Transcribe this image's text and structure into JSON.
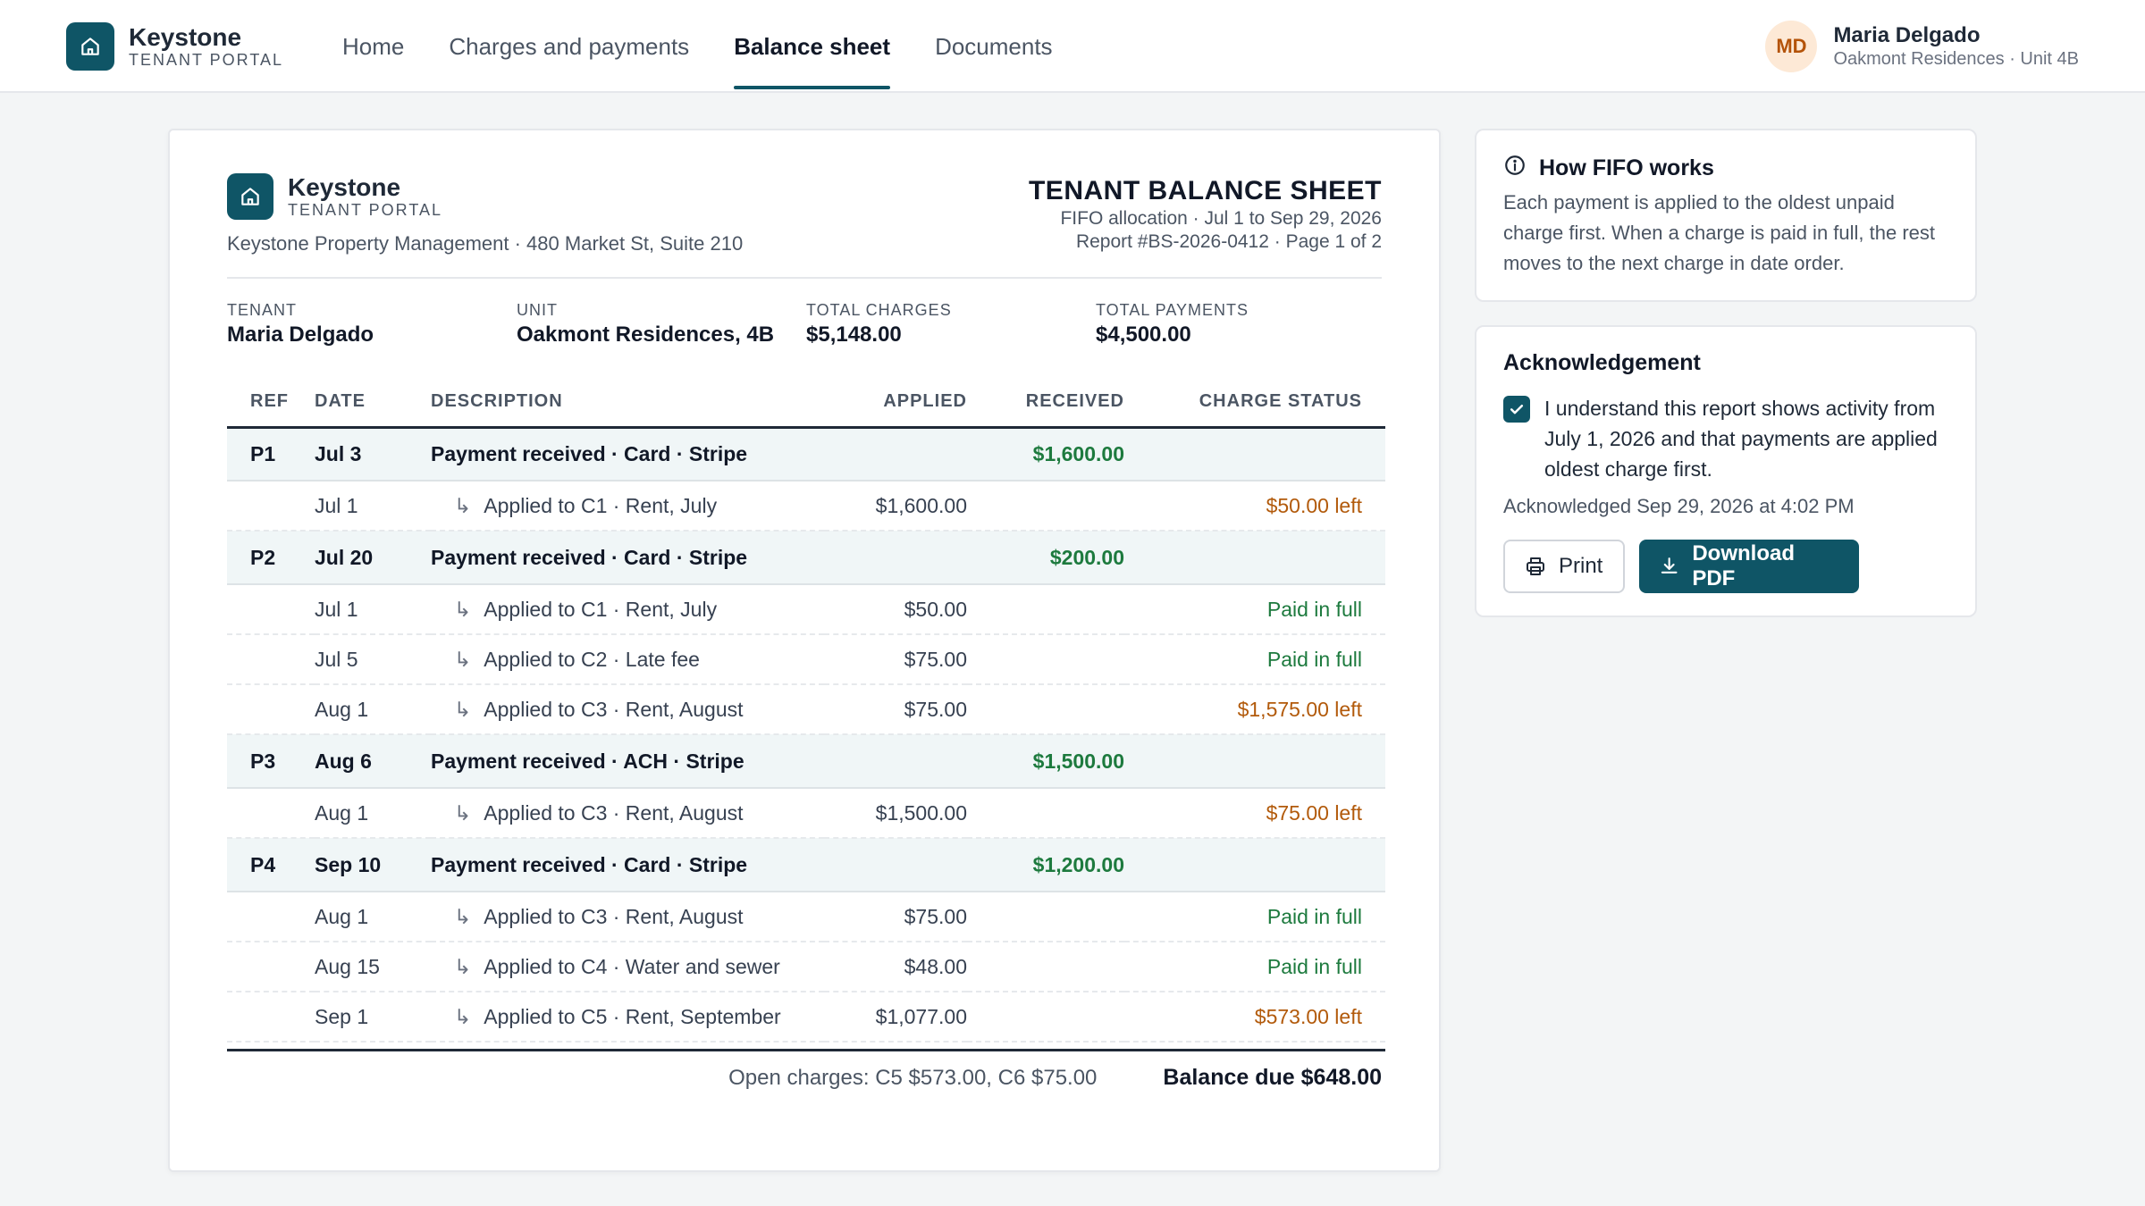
{
  "app": {
    "name": "Keystone",
    "subtitle": "TENANT PORTAL"
  },
  "nav": {
    "tabs": [
      "Home",
      "Charges and payments",
      "Balance sheet",
      "Documents"
    ],
    "active": "Balance sheet"
  },
  "user": {
    "initials": "MD",
    "name": "Maria Delgado",
    "property": "Oakmont Residences · Unit 4B"
  },
  "report": {
    "brand_name": "Keystone",
    "brand_sub": "TENANT PORTAL",
    "address": "Keystone Property Management · 480 Market St, Suite 210",
    "title": "TENANT BALANCE SHEET",
    "period": "FIFO allocation · Jul 1 to Sep 29, 2026",
    "report_id": "Report #BS-2026-0412 · Page 1 of 2",
    "summary": {
      "tenant_label": "TENANT",
      "tenant_value": "Maria Delgado",
      "unit_label": "UNIT",
      "unit_value": "Oakmont Residences, 4B",
      "charges_label": "TOTAL CHARGES",
      "charges_value": "$5,148.00",
      "payments_label": "TOTAL PAYMENTS",
      "payments_value": "$4,500.00"
    },
    "columns": {
      "ref": "REF",
      "date": "DATE",
      "description": "DESCRIPTION",
      "applied": "APPLIED",
      "received": "RECEIVED",
      "status": "CHARGE STATUS"
    },
    "rows": [
      {
        "type": "payment",
        "ref": "P1",
        "date": "Jul 3",
        "description": "Payment received · Card · Stripe",
        "applied": "",
        "received": "$1,600.00",
        "status": ""
      },
      {
        "type": "alloc",
        "ref": "",
        "date": "Jul 1",
        "description": "Applied to C1 · Rent, July",
        "applied": "$1,600.00",
        "received": "",
        "status": "$50.00 left",
        "status_kind": "left"
      },
      {
        "type": "payment",
        "ref": "P2",
        "date": "Jul 20",
        "description": "Payment received · Card · Stripe",
        "applied": "",
        "received": "$200.00",
        "status": ""
      },
      {
        "type": "alloc",
        "ref": "",
        "date": "Jul 1",
        "description": "Applied to C1 · Rent, July",
        "applied": "$50.00",
        "received": "",
        "status": "Paid in full",
        "status_kind": "paid"
      },
      {
        "type": "alloc",
        "ref": "",
        "date": "Jul 5",
        "description": "Applied to C2 · Late fee",
        "applied": "$75.00",
        "received": "",
        "status": "Paid in full",
        "status_kind": "paid"
      },
      {
        "type": "alloc",
        "ref": "",
        "date": "Aug 1",
        "description": "Applied to C3 · Rent, August",
        "applied": "$75.00",
        "received": "",
        "status": "$1,575.00 left",
        "status_kind": "left"
      },
      {
        "type": "payment",
        "ref": "P3",
        "date": "Aug 6",
        "description": "Payment received · ACH · Stripe",
        "applied": "",
        "received": "$1,500.00",
        "status": ""
      },
      {
        "type": "alloc",
        "ref": "",
        "date": "Aug 1",
        "description": "Applied to C3 · Rent, August",
        "applied": "$1,500.00",
        "received": "",
        "status": "$75.00 left",
        "status_kind": "left"
      },
      {
        "type": "payment",
        "ref": "P4",
        "date": "Sep 10",
        "description": "Payment received · Card · Stripe",
        "applied": "",
        "received": "$1,200.00",
        "status": ""
      },
      {
        "type": "alloc",
        "ref": "",
        "date": "Aug 1",
        "description": "Applied to C3 · Rent, August",
        "applied": "$75.00",
        "received": "",
        "status": "Paid in full",
        "status_kind": "paid"
      },
      {
        "type": "alloc",
        "ref": "",
        "date": "Aug 15",
        "description": "Applied to C4 · Water and sewer",
        "applied": "$48.00",
        "received": "",
        "status": "Paid in full",
        "status_kind": "paid"
      },
      {
        "type": "alloc",
        "ref": "",
        "date": "Sep 1",
        "description": "Applied to C5 · Rent, September",
        "applied": "$1,077.00",
        "received": "",
        "status": "$573.00 left",
        "status_kind": "left"
      }
    ],
    "open_charges": "Open charges: C5 $573.00, C6 $75.00",
    "balance_due": "Balance due $648.00"
  },
  "fifo_card": {
    "title": "How FIFO works",
    "body": "Each payment is applied to the oldest unpaid charge first. When a charge is paid in full, the rest moves to the next charge in date order."
  },
  "ack_card": {
    "title": "Acknowledgement",
    "checkbox_checked": true,
    "checkbox_text": "I understand this report shows activity from July 1, 2026 and that payments are applied oldest charge first.",
    "timestamp": "Acknowledged Sep 29, 2026 at 4:02 PM",
    "print_label": "Print",
    "download_label": "Download PDF"
  },
  "colors": {
    "accent": "#0f5566",
    "paid": "#1d7a3e",
    "left": "#b25a0b",
    "avatar_bg": "#fde9d6"
  }
}
